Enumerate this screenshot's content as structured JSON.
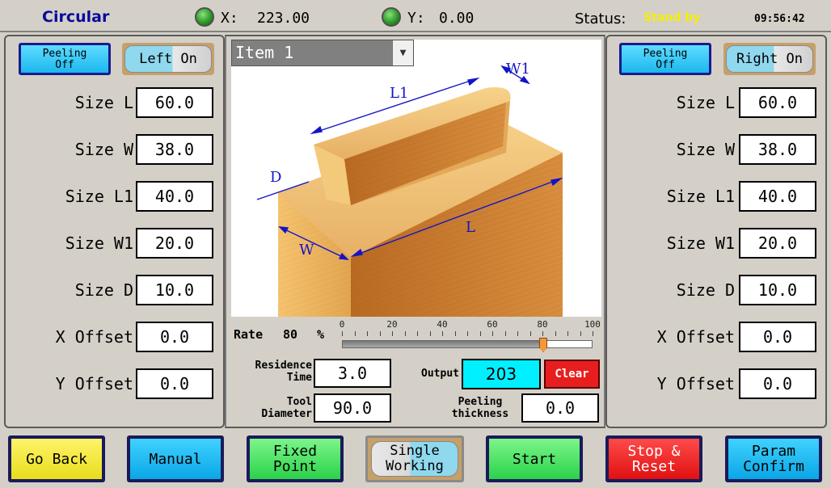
{
  "header": {
    "title": "Circular",
    "x_label": "X:",
    "x_value": "223.00",
    "y_label": "Y:",
    "y_value": "0.00",
    "status_label": "Status:",
    "status_value": "Stand by",
    "time": "09:56:42",
    "led_color": "#2f9a2a"
  },
  "left": {
    "peeling_button": "Peeling\nOff",
    "toggle_label": "Left On",
    "fields": [
      {
        "label": "Size L",
        "value": "60.0"
      },
      {
        "label": "Size W",
        "value": "38.0"
      },
      {
        "label": "Size L1",
        "value": "40.0"
      },
      {
        "label": "Size W1",
        "value": "20.0"
      },
      {
        "label": "Size D",
        "value": "10.0"
      },
      {
        "label": "X Offset",
        "value": "0.0"
      },
      {
        "label": "Y Offset",
        "value": "0.0"
      }
    ]
  },
  "right": {
    "peeling_button": "Peeling\nOff",
    "toggle_label": "Right On",
    "fields": [
      {
        "label": "Size L",
        "value": "60.0"
      },
      {
        "label": "Size W",
        "value": "38.0"
      },
      {
        "label": "Size L1",
        "value": "40.0"
      },
      {
        "label": "Size W1",
        "value": "20.0"
      },
      {
        "label": "Size D",
        "value": "10.0"
      },
      {
        "label": "X Offset",
        "value": "0.0"
      },
      {
        "label": "Y Offset",
        "value": "0.0"
      }
    ]
  },
  "center": {
    "item_select": "Item 1",
    "diagram_labels": {
      "l1": "L1",
      "w1": "W1",
      "d": "D",
      "w": "W",
      "l": "L"
    },
    "rate_label": "Rate",
    "rate_value": "80",
    "rate_unit": "%",
    "rate_fraction": 0.8,
    "slider_ticks": [
      "0",
      "20",
      "40",
      "60",
      "80",
      "100"
    ],
    "residence_time_label": "Residence\nTime",
    "residence_time_value": "3.0",
    "output_label": "Output",
    "output_value": "203",
    "clear_button": "Clear",
    "tool_diameter_label": "Tool\nDiameter",
    "tool_diameter_value": "90.0",
    "peeling_thickness_label": "Peeling\nthickness",
    "peeling_thickness_value": "0.0"
  },
  "bottom": {
    "go_back": "Go Back",
    "manual": "Manual",
    "fixed_point": "Fixed Point",
    "single_working": "Single\nWorking",
    "start": "Start",
    "stop_reset": "Stop &\nReset",
    "param_confirm": "Param\nConfirm"
  }
}
